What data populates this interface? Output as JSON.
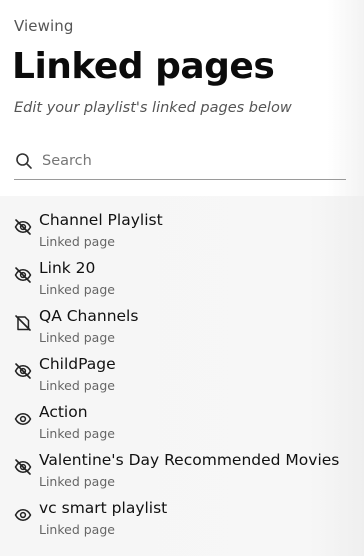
{
  "header": {
    "eyebrow": "Viewing",
    "title": "Linked pages",
    "subtitle": "Edit your playlist's linked pages below"
  },
  "search": {
    "placeholder": "Search",
    "value": "",
    "icon": "search-icon"
  },
  "items": [
    {
      "title": "Channel Playlist",
      "subtitle": "Linked page",
      "icon": "eye-off-icon"
    },
    {
      "title": "Link 20",
      "subtitle": "Linked page",
      "icon": "eye-off-icon"
    },
    {
      "title": "QA Channels",
      "subtitle": "Linked page",
      "icon": "file-off-icon"
    },
    {
      "title": "ChildPage",
      "subtitle": "Linked page",
      "icon": "eye-off-icon"
    },
    {
      "title": "Action",
      "subtitle": "Linked page",
      "icon": "eye-icon"
    },
    {
      "title": "Valentine's Day Recommended Movies",
      "subtitle": "Linked page",
      "icon": "eye-off-icon"
    },
    {
      "title": "vc smart playlist",
      "subtitle": "Linked page",
      "icon": "eye-icon"
    }
  ]
}
